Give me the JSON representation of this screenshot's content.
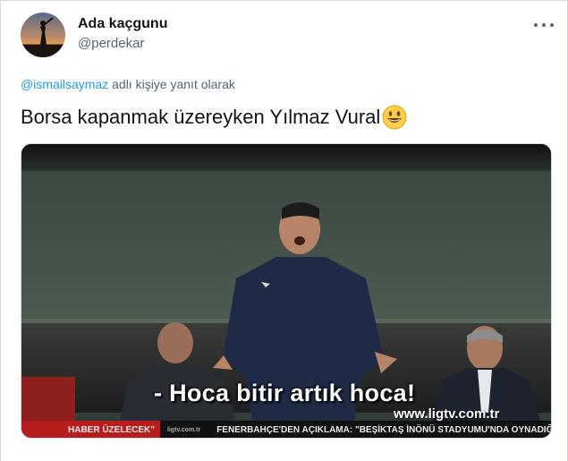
{
  "tweet": {
    "display_name": "Ada kaçgunu",
    "handle": "@perdekar",
    "reply_mention": "@ismailsaymaz",
    "reply_suffix": " adlı kişiye yanıt olarak",
    "text": "Borsa kapanmak üzereyken Yılmaz Vural",
    "emoji": "smiley-emoji"
  },
  "media": {
    "subtitle": "- Hoca bitir artık hoca!",
    "watermark": "www.ligtv.com.tr",
    "ticker_label": "HABER ÜZELECEK\"",
    "ticker_site": "ligtv.com.tr",
    "ticker_text": "FENERBAHÇE'DEN AÇIKLAMA: \"BEŞİKTAŞ İNÖNÜ STADYUMU'NDA OYNADIĞIMIZ"
  },
  "icons": {
    "more": "more-dots-icon",
    "avatar": "avatar"
  },
  "colors": {
    "link": "#1d9bf0",
    "secondary_text": "#536471",
    "primary_text": "#0f1419",
    "border": "#cfd9de"
  }
}
